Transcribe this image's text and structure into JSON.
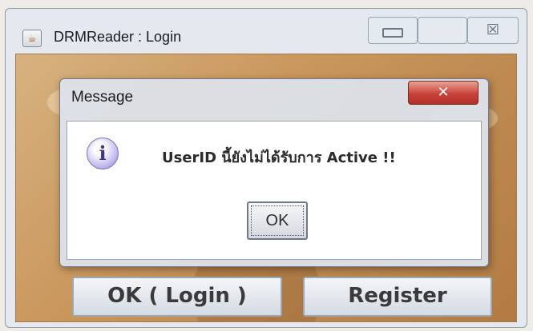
{
  "outer_window": {
    "title": "DRMReader : Login",
    "buttons": {
      "login": "OK ( Login )",
      "register": "Register"
    },
    "controls": {
      "minimize_icon": "minimize-icon",
      "maximize_icon": "maximize-icon",
      "close_glyph": "☒"
    }
  },
  "dialog": {
    "title": "Message",
    "close_glyph": "✕",
    "icon": "info-icon",
    "icon_glyph": "i",
    "message": "UserID นี้ยังไม่ได้รับการ Active !!",
    "ok_label": "OK"
  }
}
